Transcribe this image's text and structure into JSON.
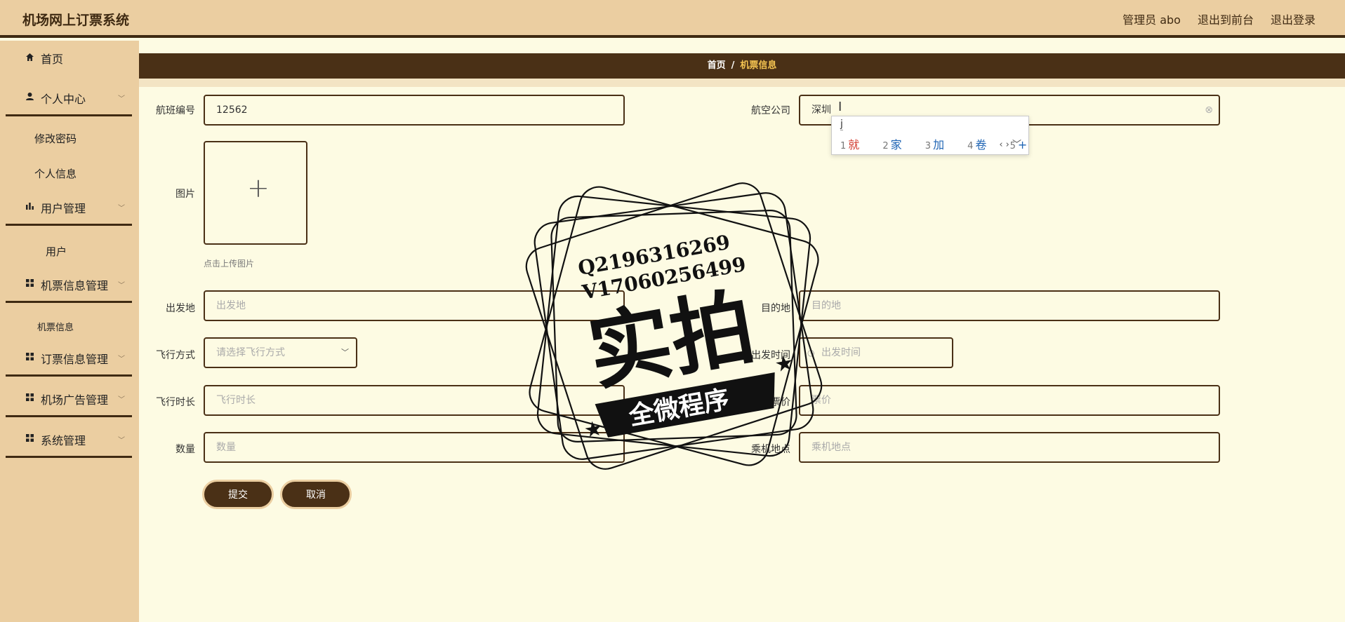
{
  "header": {
    "title": "机场网上订票系统",
    "user": "管理员 abo",
    "to_frontend": "退出到前台",
    "logout": "退出登录"
  },
  "sidebar": {
    "home": "首页",
    "personal_center": "个人中心",
    "change_password": "修改密码",
    "personal_info": "个人信息",
    "user_mgmt": "用户管理",
    "user": "用户",
    "ticket_mgmt": "机票信息管理",
    "ticket_info": "机票信息",
    "order_mgmt": "订票信息管理",
    "ad_mgmt": "机场广告管理",
    "system_mgmt": "系统管理"
  },
  "breadcrumb": {
    "home": "首页",
    "separator": "/",
    "current": "机票信息"
  },
  "form": {
    "flight_no_label": "航班编号",
    "flight_no_value": "12562",
    "airline_label": "航空公司",
    "airline_value": "深圳",
    "image_label": "图片",
    "upload_hint": "点击上传图片",
    "origin_label": "出发地",
    "origin_placeholder": "出发地",
    "destination_label": "目的地",
    "destination_placeholder": "目的地",
    "flight_mode_label": "飞行方式",
    "flight_mode_placeholder": "请选择飞行方式",
    "depart_time_label": "出发时间",
    "depart_time_placeholder": "出发时间",
    "duration_label": "飞行时长",
    "duration_placeholder": "飞行时长",
    "price_label": "票价",
    "price_placeholder": "票价",
    "quantity_label": "数量",
    "quantity_placeholder": "数量",
    "boarding_label": "乘机地点",
    "boarding_placeholder": "乘机地点",
    "submit": "提交",
    "cancel": "取消"
  },
  "ime": {
    "composition": "j",
    "candidates": [
      {
        "n": "1",
        "text": "就"
      },
      {
        "n": "2",
        "text": "家"
      },
      {
        "n": "3",
        "text": "加"
      },
      {
        "n": "4",
        "text": "卷"
      },
      {
        "n": "5",
        "text": "+"
      }
    ]
  },
  "watermark": {
    "line1": "Q2196316269",
    "line2": "V17060256499",
    "big": "实拍",
    "banner": "全微程序"
  }
}
